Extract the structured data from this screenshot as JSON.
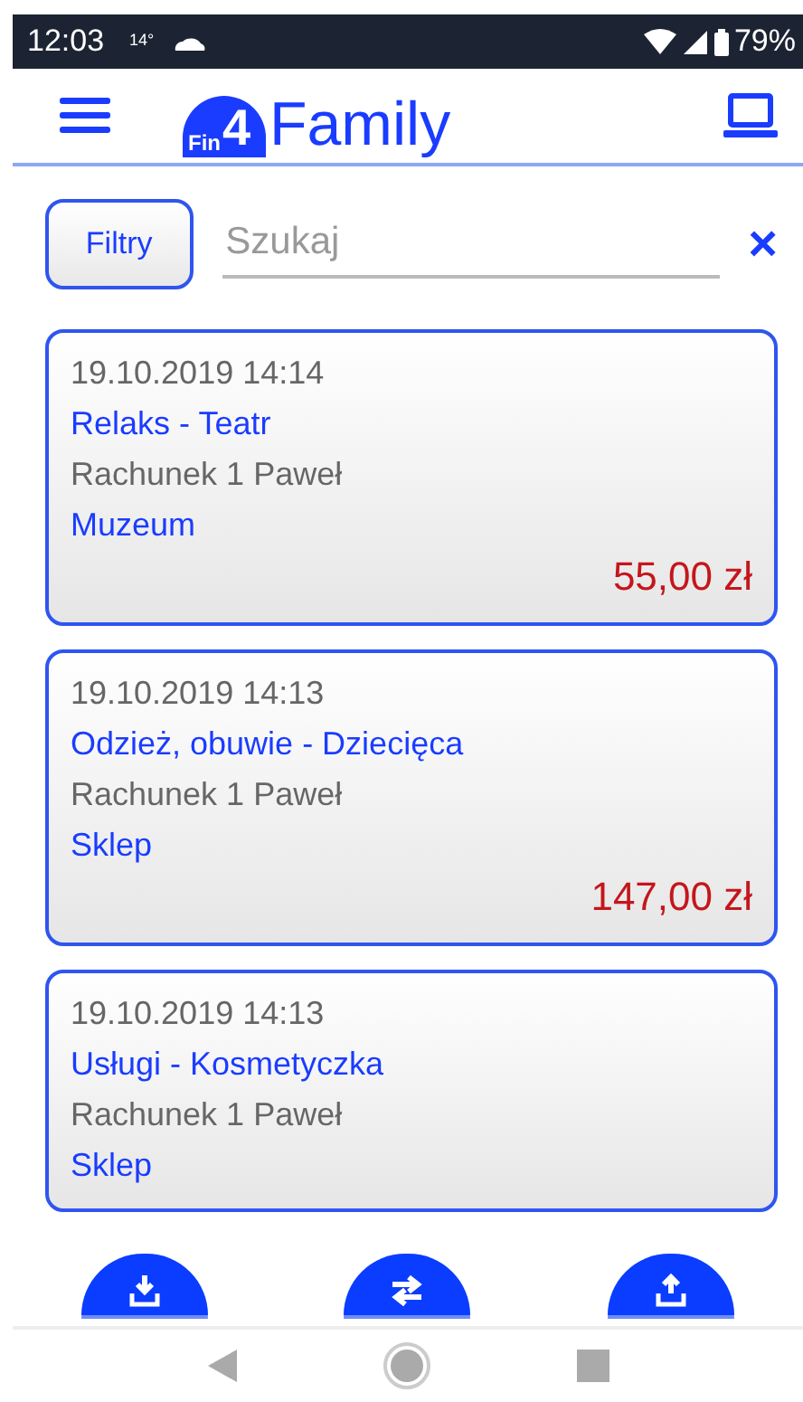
{
  "status_bar": {
    "time": "12:03",
    "temperature": "14°",
    "battery": "79%"
  },
  "header": {
    "logo_badge": "Fin",
    "logo_digit": "4",
    "logo_text": "Family"
  },
  "filter_bar": {
    "filter_button": "Filtry",
    "search_placeholder": "Szukaj",
    "clear": "×"
  },
  "transactions": [
    {
      "datetime": "19.10.2019 14:14",
      "category": "Relaks - Teatr",
      "account": "Rachunek 1 Paweł",
      "place": "Muzeum",
      "amount": "55,00 zł"
    },
    {
      "datetime": "19.10.2019 14:13",
      "category": "Odzież, obuwie - Dziecięca",
      "account": "Rachunek 1 Paweł",
      "place": "Sklep",
      "amount": "147,00 zł"
    },
    {
      "datetime": "19.10.2019 14:13",
      "category": "Usługi - Kosmetyczka",
      "account": "Rachunek 1 Paweł",
      "place": "Sklep"
    }
  ],
  "bottom_actions": [
    {
      "kind": "import"
    },
    {
      "kind": "transfer"
    },
    {
      "kind": "export"
    }
  ]
}
